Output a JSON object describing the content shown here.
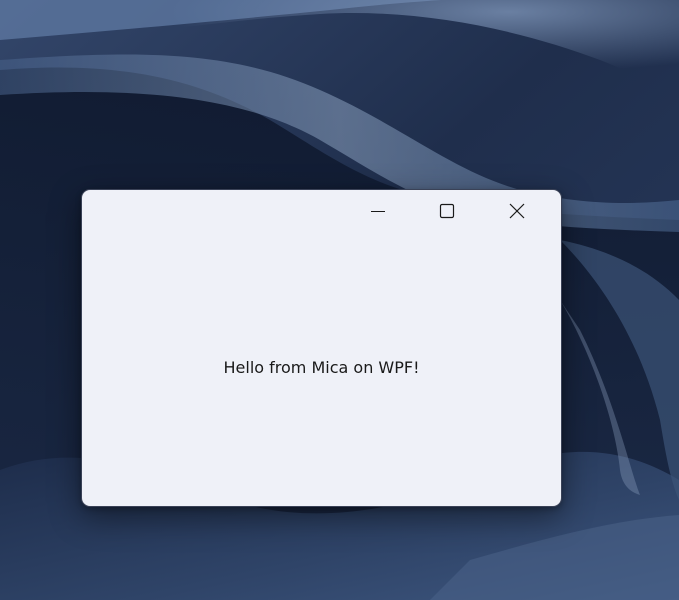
{
  "window": {
    "message": "Hello from Mica on WPF!",
    "caption_buttons": {
      "minimize_icon": "minimize-icon",
      "maximize_icon": "maximize-icon",
      "close_icon": "close-icon"
    }
  },
  "colors": {
    "window_background": "#eff1f8",
    "text": "#1a1a1a",
    "desktop_dark": "#0f1a30",
    "desktop_mid": "#2c3e60",
    "desktop_light": "#6d86a8"
  }
}
